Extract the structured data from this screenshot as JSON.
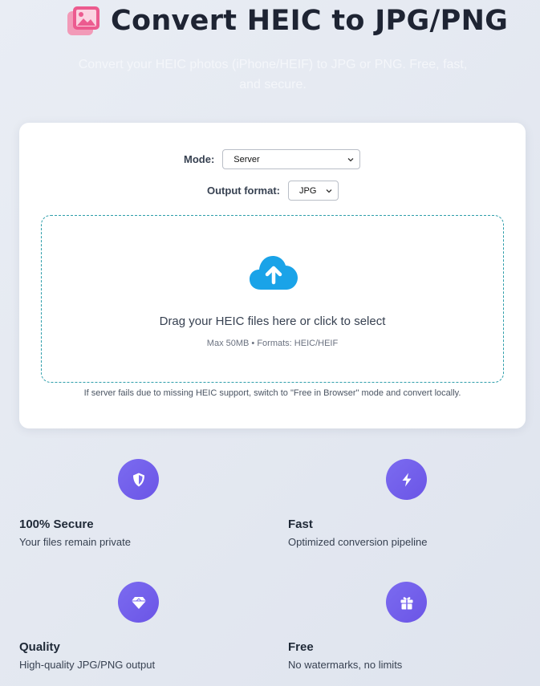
{
  "header": {
    "title": "Convert HEIC to JPG/PNG",
    "subtitle": "Convert your HEIC photos (iPhone/HEIF) to JPG or PNG. Free, fast, and secure.",
    "icon": "images-icon"
  },
  "converter": {
    "mode_label": "Mode:",
    "mode_value": "Server",
    "format_label": "Output format:",
    "format_value": "JPG",
    "dropzone_text": "Drag your HEIC files here or click to select",
    "dropzone_subtext": "Max 50MB • Formats: HEIC/HEIF",
    "note": "If server fails due to missing HEIC support, switch to \"Free in Browser\" mode and convert locally."
  },
  "features": [
    {
      "icon": "shield-icon",
      "title": "100% Secure",
      "desc": "Your files remain private"
    },
    {
      "icon": "bolt-icon",
      "title": "Fast",
      "desc": "Optimized conversion pipeline"
    },
    {
      "icon": "gem-icon",
      "title": "Quality",
      "desc": "High-quality JPG/PNG output"
    },
    {
      "icon": "gift-icon",
      "title": "Free",
      "desc": "No watermarks, no limits"
    }
  ],
  "colors": {
    "accent_purple": "#6b55e6",
    "upload_blue": "#1aa3e8",
    "title_icon_pink": "#ec5b8f",
    "dropzone_border": "#2e9eaa"
  }
}
